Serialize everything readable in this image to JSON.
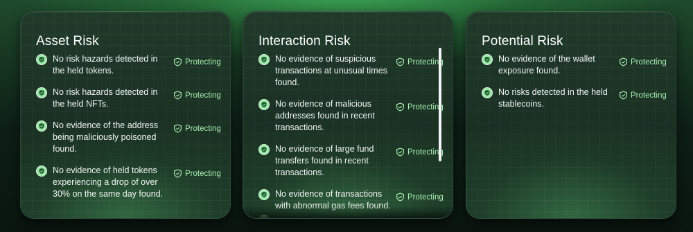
{
  "cards": [
    {
      "title": "Asset Risk",
      "items": [
        {
          "text": "No risk hazards detected in the held tokens.",
          "status": "Protecting"
        },
        {
          "text": "No risk hazards detected in the held NFTs.",
          "status": "Protecting"
        },
        {
          "text": "No evidence of the address being maliciously poisoned found.",
          "status": "Protecting"
        },
        {
          "text": "No evidence of held tokens experiencing a drop of over 30% on the same day found.",
          "status": "Protecting"
        }
      ]
    },
    {
      "title": "Interaction Risk",
      "items": [
        {
          "text": "No evidence of suspicious transactions at unusual times found.",
          "status": "Protecting"
        },
        {
          "text": "No evidence of malicious addresses found in recent transactions.",
          "status": "Protecting"
        },
        {
          "text": "No evidence of large fund transfers found in recent transactions.",
          "status": "Protecting"
        },
        {
          "text": "No evidence of transactions with abnormal gas fees found.",
          "status": "Protecting"
        }
      ]
    },
    {
      "title": "Potential Risk",
      "items": [
        {
          "text": "No evidence of the wallet exposure found.",
          "status": "Protecting"
        },
        {
          "text": "No risks detected in the held stablecoins.",
          "status": "Protecting"
        }
      ]
    }
  ],
  "icons": {
    "check": "shield-check-icon",
    "status": "shield-icon"
  },
  "colors": {
    "accent": "#a7f0b0",
    "check_fill": "#9be6a8"
  }
}
